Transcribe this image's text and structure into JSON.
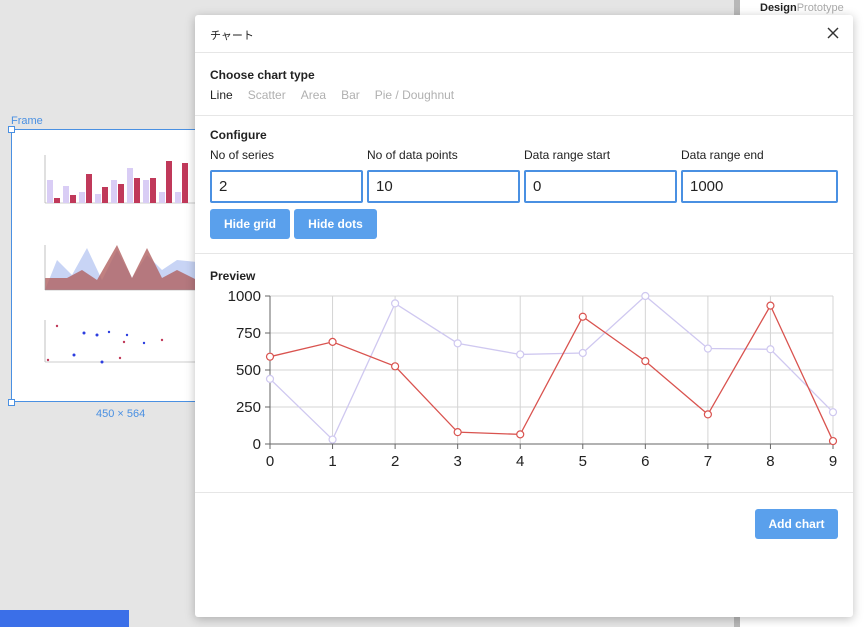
{
  "canvas": {
    "frame_label": "Frame",
    "frame_size": "450 × 564"
  },
  "right_panel": {
    "tab_design": "Design",
    "tab_prototype": "Prototype"
  },
  "dialog": {
    "title": "チャート",
    "chart_type": {
      "heading": "Choose chart type",
      "options": [
        "Line",
        "Scatter",
        "Area",
        "Bar",
        "Pie / Doughnut"
      ],
      "selected": "Line"
    },
    "configure": {
      "heading": "Configure",
      "series_label": "No of series",
      "series_value": "2",
      "points_label": "No of data points",
      "points_value": "10",
      "range_start_label": "Data range start",
      "range_start_value": "0",
      "range_end_label": "Data range end",
      "range_end_value": "1000",
      "hide_grid_label": "Hide grid",
      "hide_dots_label": "Hide dots"
    },
    "preview": {
      "heading": "Preview"
    },
    "add_chart_label": "Add chart"
  },
  "chart_data": {
    "type": "line",
    "x": [
      0,
      1,
      2,
      3,
      4,
      5,
      6,
      7,
      8,
      9
    ],
    "series": [
      {
        "values": [
          590,
          690,
          525,
          80,
          65,
          860,
          560,
          200,
          935,
          20
        ],
        "color": "#d9534f"
      },
      {
        "values": [
          440,
          30,
          950,
          680,
          605,
          615,
          1000,
          645,
          640,
          215
        ],
        "color": "#cfc8f0"
      }
    ],
    "ylim": [
      0,
      1000
    ],
    "y_ticks": [
      0,
      250,
      500,
      750,
      1000
    ],
    "grid": true
  }
}
